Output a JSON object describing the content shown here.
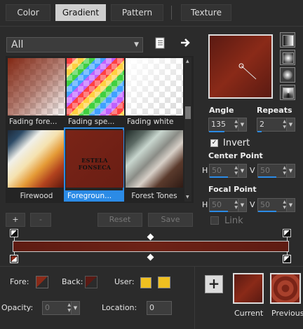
{
  "tabs": [
    {
      "label": "Color"
    },
    {
      "label": "Gradient"
    },
    {
      "label": "Pattern"
    },
    {
      "label": "Texture"
    }
  ],
  "library": {
    "filter_value": "All",
    "items": [
      {
        "label": "Fading fore..."
      },
      {
        "label": "Fading spe..."
      },
      {
        "label": "Fading white"
      },
      {
        "label": "Firewood"
      },
      {
        "label": "Foregroun..."
      },
      {
        "label": "Forest Tones"
      }
    ],
    "watermark": "ESTELA FONSECA",
    "add_label": "+",
    "remove_label": "-",
    "reset_label": "Reset",
    "save_label": "Save"
  },
  "angle": {
    "label": "Angle",
    "value": "135"
  },
  "repeats": {
    "label": "Repeats",
    "value": "2"
  },
  "invert": {
    "label": "Invert",
    "checked": true
  },
  "center_point": {
    "label": "Center Point",
    "h_label": "H",
    "h_value": "50",
    "v_label": "V",
    "v_value": "50"
  },
  "focal_point": {
    "label": "Focal Point",
    "h_label": "H",
    "h_value": "50",
    "v_label": "V",
    "v_value": "50"
  },
  "link": {
    "label": "Link"
  },
  "bottom": {
    "fore_label": "Fore:",
    "back_label": "Back:",
    "user_label": "User:",
    "opacity_label": "Opacity:",
    "opacity_value": "0",
    "location_label": "Location:",
    "location_value": "0",
    "add_label": "+",
    "current_label": "Current",
    "previous_label": "Previous"
  },
  "colors": {
    "accent": "#2b8be6",
    "gradient_dark": "#5a1a12",
    "gradient_mid": "#8a2a18",
    "user_swatch": "#f0c020"
  }
}
